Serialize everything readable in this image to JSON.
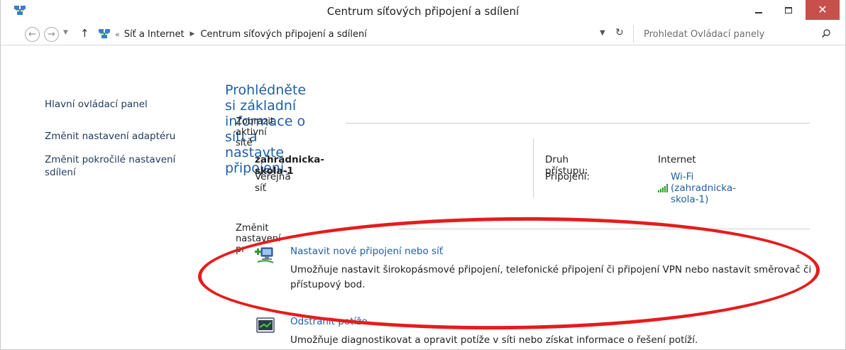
{
  "window": {
    "title": "Centrum síťových připojení a sdílení",
    "close_glyph": "✕"
  },
  "nav": {
    "back_glyph": "←",
    "forward_glyph": "→",
    "up_glyph": "↑",
    "address_sep": "«",
    "breadcrumb": [
      "Síť a Internet",
      "Centrum síťových připojení a sdílení"
    ],
    "refresh_glyph": "↻",
    "search_placeholder": "Prohledat Ovládací panely"
  },
  "sidebar": {
    "items": [
      {
        "label": "Hlavní ovládací panel"
      },
      {
        "label": "Změnit nastavení adaptéru"
      },
      {
        "label": "Změnit pokročilé nastavení sdílení"
      }
    ]
  },
  "main": {
    "title": "Prohlédněte si základní informace o síti a nastavte připojení.",
    "active_section": "Zobrazit aktivní sítě",
    "network": {
      "name": "zahradnicka-skola-1",
      "type": "Veřejná síť",
      "access_label": "Druh přístupu:",
      "access_value": "Internet",
      "connection_label": "Připojení:",
      "connection_value": "Wi-Fi (zahradnicka-skola-1)"
    },
    "change_section": "Změnit nastavení pr",
    "tasks": [
      {
        "title": "Nastavit nové připojení nebo síť",
        "desc": "Umožňuje nastavit širokopásmové připojení, telefonické připojení či připojení VPN nebo nastavit směrovač či přístupový bod."
      },
      {
        "title": "Odstranit potíže",
        "desc": "Umožňuje diagnostikovat a opravit potíže v síti nebo získat informace o řešení potíží."
      }
    ]
  },
  "colors": {
    "link": "#1e5fa6",
    "sidebar_link": "#1e395b",
    "close_button": "#c7504b",
    "annotation_oval": "#e51c1c",
    "wifi": "#2e9b2e"
  },
  "icons": [
    "network-center-icon",
    "back-icon",
    "forward-icon",
    "up-icon",
    "refresh-icon",
    "search-icon",
    "wifi-signal-icon",
    "new-connection-icon",
    "troubleshoot-icon"
  ]
}
